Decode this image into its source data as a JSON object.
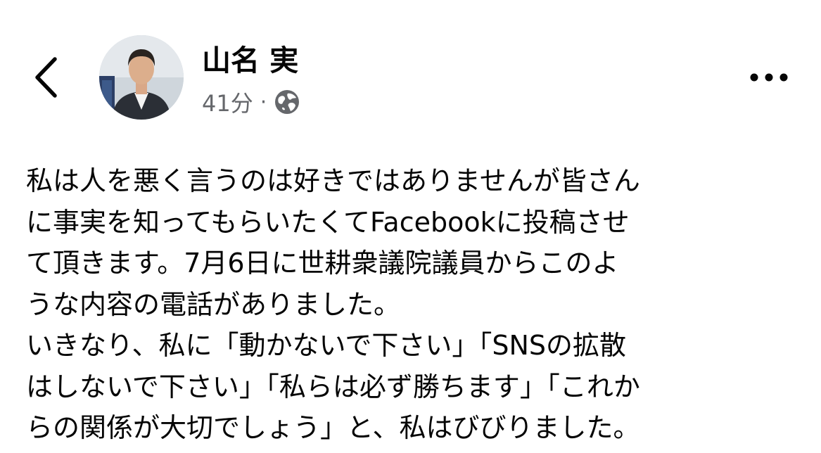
{
  "header": {
    "author_name": "山名 実",
    "timestamp": "41分",
    "separator": "·",
    "audience_icon": "globe-icon",
    "back_icon": "chevron-left-icon",
    "more_icon": "more-horizontal-icon"
  },
  "post": {
    "lines": [
      "私は人を悪く言うのは好きではありませんが皆さん",
      "に事実を知ってもらいたくてFacebookに投稿させ",
      "て頂きます。7月6日に世耕衆議院議員からこのよ",
      "うな内容の電話がありました。",
      "いきなり、私に「動かないで下さい」「SNSの拡散",
      "はしないで下さい」「私らは必ず勝ちます」「これか",
      "らの関係が大切でしょう」と、私はびびりました。"
    ]
  },
  "colors": {
    "text_primary": "#050505",
    "text_secondary": "#65676b",
    "background": "#ffffff"
  }
}
